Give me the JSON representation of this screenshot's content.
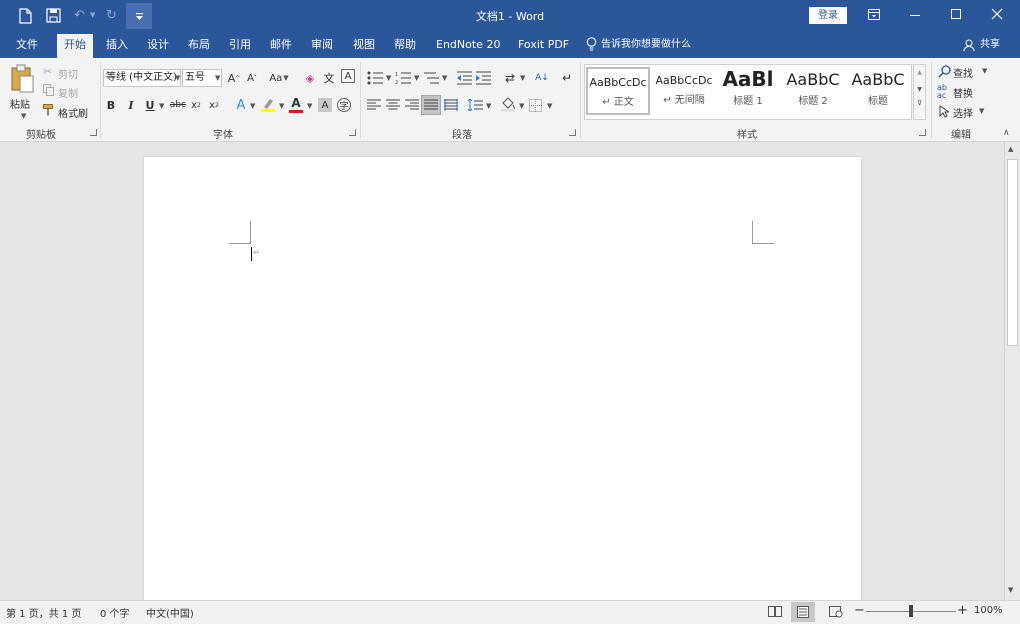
{
  "title": "文档1  -  Word",
  "login_label": "登录",
  "tabs": [
    "文件",
    "开始",
    "插入",
    "设计",
    "布局",
    "引用",
    "邮件",
    "审阅",
    "视图",
    "帮助",
    "EndNote 20",
    "Foxit PDF"
  ],
  "tell_me": "告诉我你想要做什么",
  "share": "共享",
  "clipboard": {
    "paste": "粘贴",
    "cut": "剪切",
    "copy": "复制",
    "format_painter": "格式刷",
    "group": "剪贴板"
  },
  "font": {
    "name": "等线 (中文正文)",
    "size": "五号",
    "group": "字体",
    "bold": "B",
    "italic": "I",
    "underline": "U",
    "strike": "abc"
  },
  "paragraph": {
    "group": "段落"
  },
  "styles": {
    "group": "样式",
    "items": [
      {
        "preview": "AaBbCcDc",
        "name": "↵ 正文"
      },
      {
        "preview": "AaBbCcDc",
        "name": "↵ 无间隔"
      },
      {
        "preview": "AaBl",
        "name": "标题 1"
      },
      {
        "preview": "AaBbC",
        "name": "标题 2"
      },
      {
        "preview": "AaBbC",
        "name": "标题"
      }
    ]
  },
  "editing": {
    "find": "查找",
    "replace": "替换",
    "select": "选择",
    "group": "编辑"
  },
  "status": {
    "page": "第 1 页，共 1 页",
    "words": "0 个字",
    "lang": "中文(中国)",
    "zoom": "100%",
    "zoom_fraction": 0.5
  },
  "colors": {
    "brand": "#2b579a",
    "highlight": "#ffff00",
    "font_color": "#e81123"
  }
}
